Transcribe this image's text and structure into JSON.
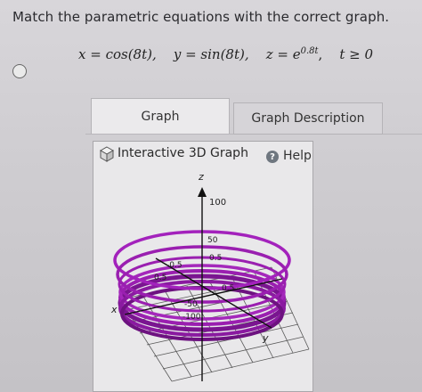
{
  "question": {
    "prompt": "Match the parametric equations with the correct graph."
  },
  "equation": {
    "x_eq": "x = cos(8t),",
    "y_eq": "y = sin(8t),",
    "z_lhs": "z = e",
    "z_exp": "0.8t",
    "domain": "t ≥ 0"
  },
  "tabs": [
    {
      "label": "Graph"
    },
    {
      "label": "Graph Description"
    }
  ],
  "graph": {
    "title": "Interactive 3D Graph",
    "help_label": "Help",
    "help_icon_glyph": "?",
    "axis_labels": {
      "z": "z",
      "x": "x",
      "y": "y"
    },
    "tick_labels": {
      "z_top": "100",
      "z_mid": "50",
      "x_neg": "-0.5",
      "x_pos": "0.5",
      "y_pos": "0.5",
      "y_pos_left": "0.5",
      "z_bottom_a": "-50",
      "z_bottom_b": "-100"
    },
    "colors": {
      "curve": "#9a1fb0",
      "curve_dark": "#6d1280",
      "grid": "#5a5a5a",
      "axis": "#111111"
    }
  }
}
